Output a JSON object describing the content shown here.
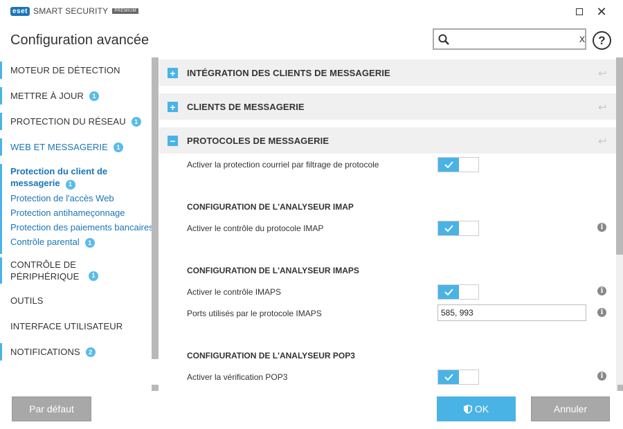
{
  "app": {
    "logo_text": "eset",
    "product_name": "SMART SECURITY",
    "product_badge": "PREMIUM"
  },
  "window": {
    "maximize_icon": "maximize-icon",
    "close_label": "✕"
  },
  "page_title": "Configuration avancée",
  "search": {
    "value": "",
    "placeholder": "",
    "clear_label": "x",
    "help_label": "?"
  },
  "sidebar": {
    "items": [
      {
        "label": "MOTEUR DE DÉTECTION",
        "badge": ""
      },
      {
        "label": "METTRE À JOUR",
        "badge": "1"
      },
      {
        "label": "PROTECTION DU RÉSEAU",
        "badge": "1"
      },
      {
        "label": "WEB ET MESSAGERIE",
        "badge": "1"
      },
      {
        "label": "CONTRÔLE DE PÉRIPHÉRIQUE",
        "badge": "1"
      },
      {
        "label": "OUTILS",
        "badge": ""
      },
      {
        "label": "INTERFACE UTILISATEUR",
        "badge": ""
      },
      {
        "label": "NOTIFICATIONS",
        "badge": "2"
      }
    ],
    "subitems": [
      {
        "label": "Protection du client de messagerie",
        "badge": "1"
      },
      {
        "label": "Protection de l'accès Web",
        "badge": ""
      },
      {
        "label": "Protection antihameçonnage",
        "badge": ""
      },
      {
        "label": "Protection des paiements bancaires",
        "badge": ""
      },
      {
        "label": "Contrôle parental",
        "badge": "1"
      }
    ]
  },
  "sections": [
    {
      "title": "INTÉGRATION DES CLIENTS DE MESSAGERIE",
      "toggle": "+"
    },
    {
      "title": "CLIENTS DE MESSAGERIE",
      "toggle": "+"
    },
    {
      "title": "PROTOCOLES DE MESSAGERIE",
      "toggle": "−"
    }
  ],
  "settings": {
    "filter_protocol": {
      "label": "Activer la protection courriel par filtrage de protocole",
      "enabled": true
    },
    "imap_head": "CONFIGURATION DE L'ANALYSEUR IMAP",
    "imap_enable": {
      "label": "Activer le contrôle du protocole IMAP",
      "enabled": true
    },
    "imaps_head": "CONFIGURATION DE L'ANALYSEUR IMAPS",
    "imaps_enable": {
      "label": "Activer le contrôle IMAPS",
      "enabled": true
    },
    "imaps_ports": {
      "label": "Ports utilisés par le protocole IMAPS",
      "value": "585, 993"
    },
    "pop3_head": "CONFIGURATION DE L'ANALYSEUR POP3",
    "pop3_enable": {
      "label": "Activer la vérification POP3",
      "enabled": true
    }
  },
  "footer": {
    "default_label": "Par défaut",
    "ok_label": "OK",
    "cancel_label": "Annuler"
  },
  "colors": {
    "accent": "#4ab3e6",
    "brand": "#1a75b8",
    "button_gray": "#a8a8a8"
  }
}
